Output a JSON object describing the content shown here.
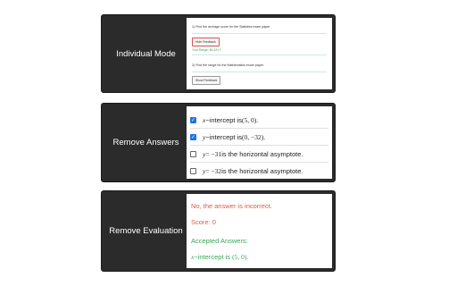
{
  "card1": {
    "label": "Individual Mode",
    "q1_text": "1) Find the average score for the Statistics exam paper.",
    "hide_feedback": "Hide Feedback",
    "feedback_text": "Your Range: 86.324 T",
    "q2_text": "2) Find the range for the Mathematics exam paper.",
    "show_feedback": "Show Feedback"
  },
  "card2": {
    "label": "Remove Answers",
    "options": [
      {
        "var": "x",
        "pre": "−intercept is ",
        "expr": "(5, 0).",
        "checked": true
      },
      {
        "var": "y",
        "pre": "−intercept is ",
        "expr": "(0, −32).",
        "checked": true
      },
      {
        "var": "y",
        "pre": " = −31",
        "expr": "is the horizontal asymptote.",
        "checked": false
      },
      {
        "var": "y",
        "pre": " = −32",
        "expr": " is the horizontal asymptote.",
        "checked": false
      }
    ]
  },
  "card3": {
    "label": "Remove Evaluation",
    "incorrect": "No, the answer is incorrect.",
    "score": "Score: 0",
    "accepted_label": "Accepted Answers:",
    "acc_var": "x",
    "acc_mid": "−intercept is ",
    "acc_expr": "(5, 0)."
  },
  "colors": {
    "card_bg": "#2b2b2b",
    "checkbox_checked": "#1a73e8",
    "error": "#e05a48",
    "success": "#3aa55a"
  }
}
